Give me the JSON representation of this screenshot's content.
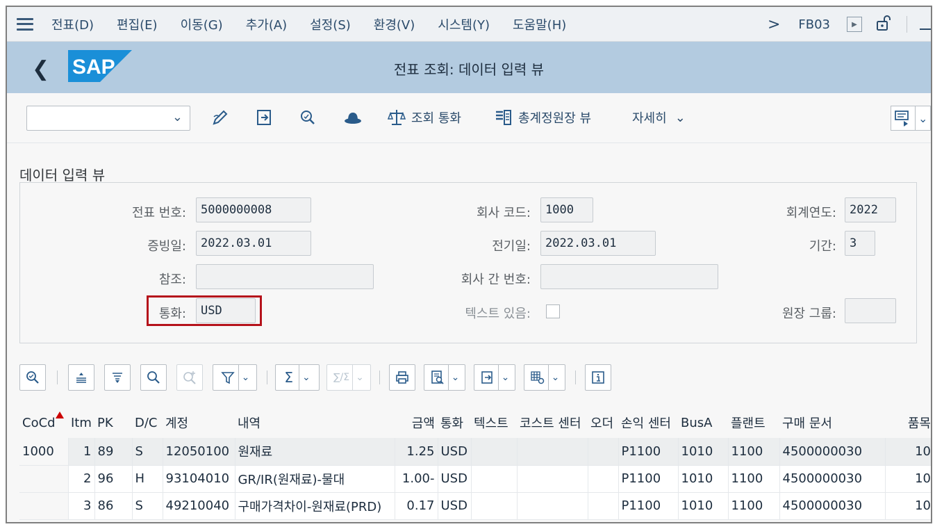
{
  "menu": {
    "items": [
      {
        "label": "전표(D)"
      },
      {
        "label": "편집(E)"
      },
      {
        "label": "이동(G)"
      },
      {
        "label": "추가(A)"
      },
      {
        "label": "설정(S)"
      },
      {
        "label": "환경(V)"
      },
      {
        "label": "시스템(Y)"
      },
      {
        "label": "도움말(H)"
      }
    ],
    "tcode": "FB03"
  },
  "header": {
    "logo_text": "SAP",
    "title": "전표 조회: 데이터 입력 뷰"
  },
  "toolbar": {
    "combo_value": "",
    "display_currency_label": "조회 통화",
    "ledger_view_label": "총계정원장 뷰",
    "more_label": "자세히"
  },
  "section": {
    "title": "데이터 입력 뷰"
  },
  "form": {
    "doc_number_label": "전표 번호:",
    "doc_number": "5000000008",
    "company_code_label": "회사 코드:",
    "company_code": "1000",
    "fiscal_year_label": "회계연도:",
    "fiscal_year": "2022",
    "doc_date_label": "증빙일:",
    "doc_date": "2022.03.01",
    "posting_date_label": "전기일:",
    "posting_date": "2022.03.01",
    "period_label": "기간:",
    "period": "3",
    "reference_label": "참조:",
    "reference": "",
    "intercompany_label": "회사 간 번호:",
    "intercompany": "",
    "currency_label": "통화:",
    "currency": "USD",
    "text_exists_label": "텍스트 있음:",
    "ledger_group_label": "원장 그룹:",
    "ledger_group": ""
  },
  "grid": {
    "columns": [
      "CoCd",
      "Itm",
      "PK",
      "D/C",
      "계정",
      "내역",
      "금액",
      "통화",
      "텍스트",
      "코스트 센터",
      "오더",
      "손익 센터",
      "BusA",
      "플랜트",
      "구매 문서",
      "품목"
    ],
    "rows": [
      {
        "cocd": "1000",
        "itm": "1",
        "pk": "89",
        "dc": "S",
        "account": "12050100",
        "desc": "원재료",
        "amount": "1.25",
        "curr": "USD",
        "text": "",
        "cost_center": "",
        "order": "",
        "profit_center": "P1100",
        "busa": "1010",
        "plant": "1100",
        "po": "4500000030",
        "item": "10"
      },
      {
        "cocd": "",
        "itm": "2",
        "pk": "96",
        "dc": "H",
        "account": "93104010",
        "desc": "GR/IR(원재료)-물대",
        "amount": "1.00-",
        "curr": "USD",
        "text": "",
        "cost_center": "",
        "order": "",
        "profit_center": "P1100",
        "busa": "1010",
        "plant": "1100",
        "po": "4500000030",
        "item": "10"
      },
      {
        "cocd": "",
        "itm": "3",
        "pk": "86",
        "dc": "S",
        "account": "49210040",
        "desc": "구매가격차이-원재료(PRD)",
        "amount": "0.17",
        "curr": "USD",
        "text": "",
        "cost_center": "",
        "order": "",
        "profit_center": "P1100",
        "busa": "1010",
        "plant": "1100",
        "po": "4500000030",
        "item": "10"
      }
    ]
  },
  "colors": {
    "title_bar": "#b3cbe0",
    "highlight": "#b5121b",
    "sap_blue": "#1a8fd8"
  }
}
